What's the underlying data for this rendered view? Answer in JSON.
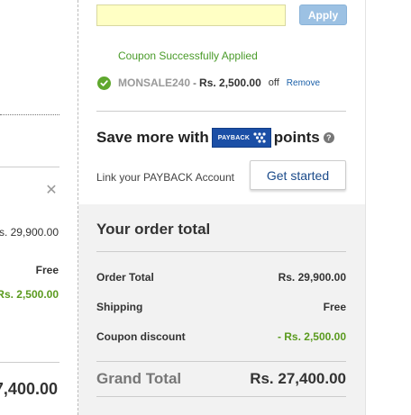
{
  "left_panel": {
    "price": "s. 29,900.00",
    "shipping": "Free",
    "discount": "Rs. 2,500.00",
    "total": "7,400.00"
  },
  "coupon": {
    "input_value": "",
    "apply_label": "Apply",
    "success_message": "Coupon Successfully Applied",
    "code": "MONSALE240",
    "separator": "-",
    "amount": "Rs. 2,500.00",
    "off_label": "off",
    "remove_label": "Remove"
  },
  "payback": {
    "heading_prefix": "Save more with",
    "logo_text": "PAYBACK",
    "heading_suffix": "points",
    "help_symbol": "?",
    "link_label": "Link your PAYBACK Account",
    "button_label": "Get started"
  },
  "order_total": {
    "title": "Your order total",
    "rows": [
      {
        "label": "Order Total",
        "value": "Rs. 29,900.00"
      },
      {
        "label": "Shipping",
        "value": "Free"
      },
      {
        "label": "Coupon discount",
        "value": "- Rs. 2,500.00"
      }
    ],
    "grand_total_label": "Grand Total",
    "grand_total_value": "Rs. 27,400.00"
  },
  "colors": {
    "coupon_input_bg": "#ffffc4",
    "apply_button": "#9cc1e3",
    "success_green": "#4a9b2a",
    "discount_green": "#5a9a1e",
    "payback_blue": "#1b4fa6",
    "link_blue": "#1a5fa8",
    "panel_bg": "#f2f2f2"
  },
  "icons": {
    "close": "close-icon",
    "check": "check-circle-icon",
    "help": "help-icon",
    "payback_logo": "payback-logo"
  }
}
